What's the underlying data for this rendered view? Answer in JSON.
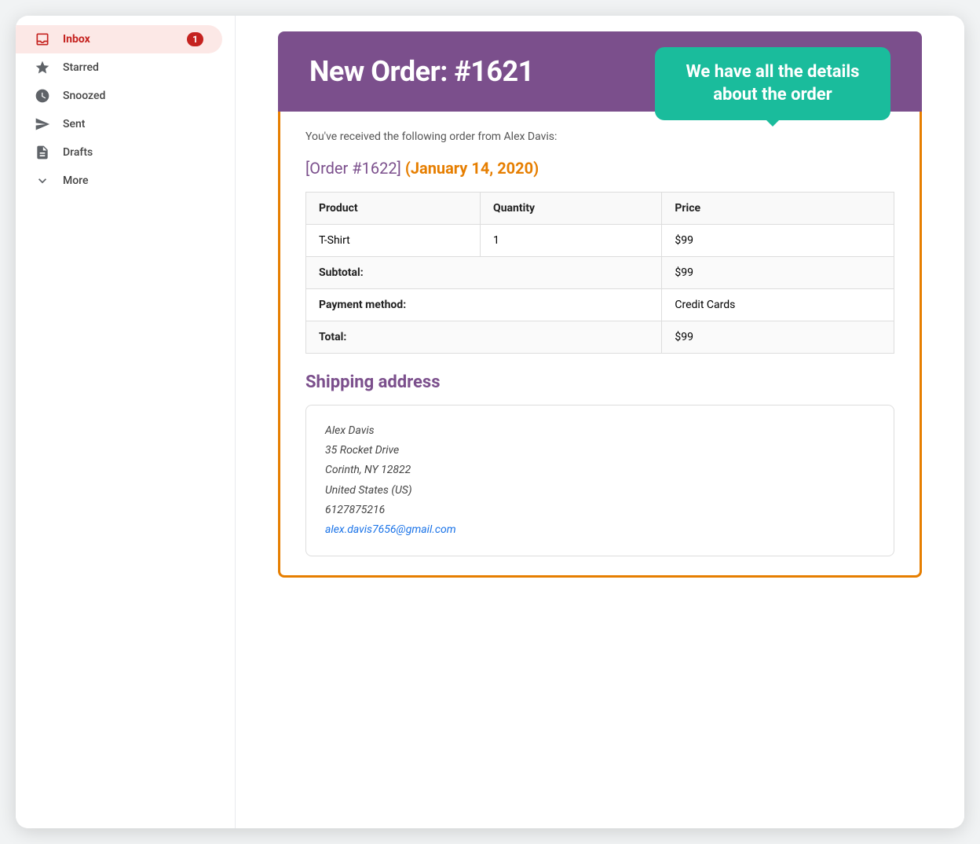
{
  "sidebar": {
    "items": [
      {
        "id": "inbox",
        "label": "Inbox",
        "icon": "inbox",
        "badge": "1",
        "active": true
      },
      {
        "id": "starred",
        "label": "Starred",
        "icon": "star",
        "badge": null,
        "active": false
      },
      {
        "id": "snoozed",
        "label": "Snoozed",
        "icon": "clock",
        "badge": null,
        "active": false
      },
      {
        "id": "sent",
        "label": "Sent",
        "icon": "send",
        "badge": null,
        "active": false
      },
      {
        "id": "drafts",
        "label": "Drafts",
        "icon": "draft",
        "badge": null,
        "active": false
      },
      {
        "id": "more",
        "label": "More",
        "icon": "chevron-down",
        "badge": null,
        "active": false
      }
    ]
  },
  "email": {
    "header": {
      "title": "New Order: #1621",
      "background_color": "#7b4f8c"
    },
    "tooltip": {
      "text": "We have all the details about the order",
      "background_color": "#1abc9c"
    },
    "intro_text": "You've received the following order from Alex Davis:",
    "order_link_text": "[Order #1622]",
    "order_date": "(January 14, 2020)",
    "table": {
      "headers": [
        "Product",
        "Quantity",
        "Price"
      ],
      "rows": [
        {
          "product": "T-Shirt",
          "quantity": "1",
          "price": "$99"
        }
      ],
      "subtotal_label": "Subtotal:",
      "subtotal_value": "$99",
      "payment_label": "Payment method:",
      "payment_value": "Credit Cards",
      "total_label": "Total:",
      "total_value": "$99"
    },
    "shipping_section": {
      "title": "Shipping address",
      "address": {
        "name": "Alex Davis",
        "street": "35 Rocket Drive",
        "city": "Corinth, NY 12822",
        "country": "United States (US)",
        "phone": "6127875216",
        "email": "alex.davis7656@gmail.com"
      }
    }
  }
}
